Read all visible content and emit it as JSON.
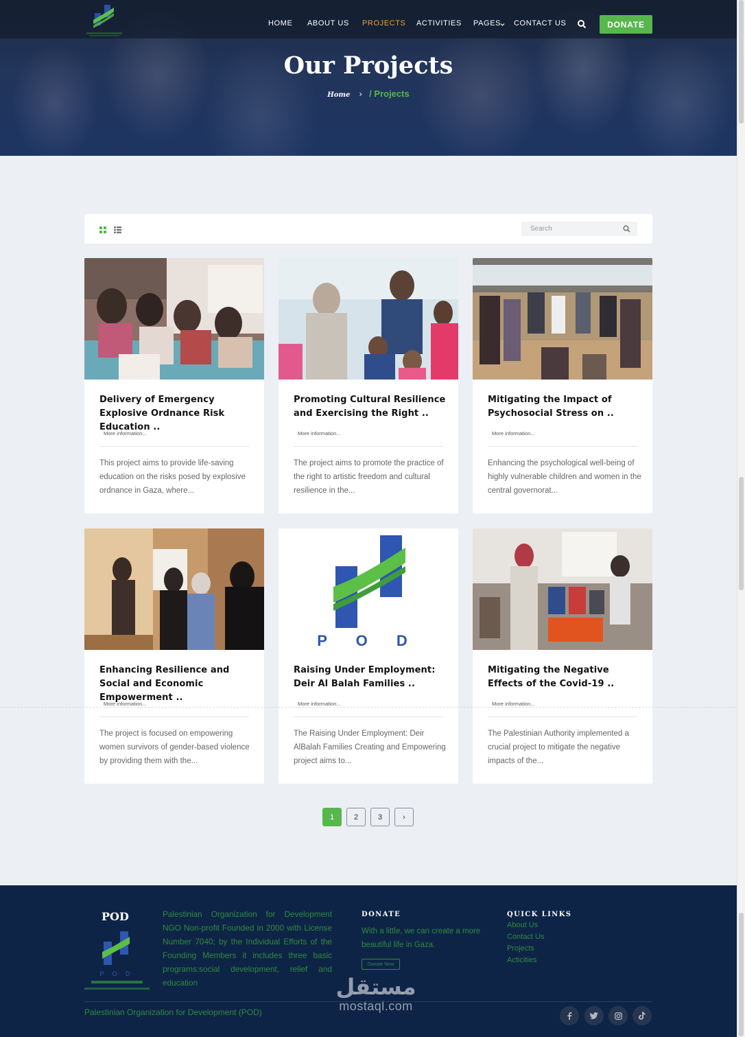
{
  "nav": {
    "items": [
      {
        "label": "HOME"
      },
      {
        "label": "ABOUT US"
      },
      {
        "label": "PROJECTS"
      },
      {
        "label": "ACTIVITIES"
      },
      {
        "label": "PAGES"
      },
      {
        "label": "CONTACT US"
      }
    ],
    "donate_label": "DONATE",
    "active_color": "#e8a23a",
    "accent_color": "#57b64c"
  },
  "hero": {
    "title": "Our Projects",
    "breadcrumb_home": "Home",
    "breadcrumb_current": "/ Projects"
  },
  "toolbar": {
    "search_placeholder": "Search",
    "view_modes": [
      "grid-icon",
      "list-icon"
    ]
  },
  "projects": [
    {
      "title": "Delivery of Emergency Explosive Ordnance Risk Education ..",
      "more": "More information...",
      "description": "This project aims to provide life-saving education on the risks posed by explosive ordnance in Gaza, where..."
    },
    {
      "title": "Promoting Cultural Resilience and Exercising the Right ..",
      "more": "More information...",
      "description": "The project aims to promote the practice of the right to artistic freedom and cultural resilience in the..."
    },
    {
      "title": "Mitigating the Impact of Psychosocial Stress on ..",
      "more": "More information...",
      "description": "Enhancing the psychological well-being of highly vulnerable children and women in the central governorat..."
    },
    {
      "title": "Enhancing Resilience and Social and Economic Empowerment ..",
      "more": "More information...",
      "description": "The project is focused on empowering women survivors of gender-based violence by providing them with the..."
    },
    {
      "title": "Raising Under Employment: Deir Al Balah Families ..",
      "more": "More information...",
      "description": "The Raising Under Employment: Deir AlBalah Families Creating and Empowering project aims to..."
    },
    {
      "title": "Mitigating the Negative Effects of the Covid-19 ..",
      "more": "More information...",
      "description": "The Palestinian Authority implemented a crucial project to mitigate the negative impacts of the..."
    }
  ],
  "pagination": {
    "pages": [
      "1",
      "2",
      "3"
    ],
    "current": "1",
    "next_symbol": "›"
  },
  "logo_text": "P O D",
  "footer": {
    "brand": "POD",
    "about": "Palestinian Organization for Development NGO Non-profit Founded in 2000 with License Number 7040; by the Individual Efforts of the Founding Members it includes three basic programs:social development, relief and education",
    "donate_heading": "DONATE",
    "donate_text": "With a little, we can create a more beautiful life in Gaza.",
    "donate_button": "Donate Now",
    "quick_links_heading": "QUICK LINKS",
    "quick_links": [
      "About Us",
      "Contact Us",
      "Projects",
      "Acticities"
    ],
    "copyright": "Palestinian Organization for Development (POD)",
    "social": [
      "f",
      "t",
      "ig",
      "tk"
    ],
    "watermark_ar": "مستقل",
    "watermark_en": "mostaql.com"
  }
}
